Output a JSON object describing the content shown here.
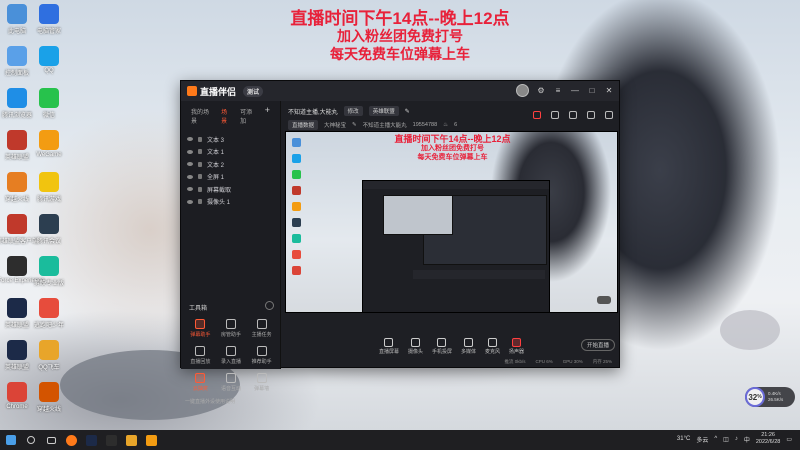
{
  "overlay": {
    "line1": "直播时间下午14点--晚上12点",
    "line2": "加入粉丝团免费打号",
    "line3": "每天免费车位弹幕上车"
  },
  "desktop": {
    "icons": [
      {
        "label": "此电脑",
        "name": "this-pc-icon",
        "color": "#4a90d9"
      },
      {
        "label": "电脑管家",
        "name": "pc-manager-icon",
        "color": "#2f6fe0"
      },
      {
        "label": "控制面板",
        "name": "control-panel-icon",
        "color": "#5aa0e8"
      },
      {
        "label": "QQ",
        "name": "qq-icon",
        "color": "#1aa1e8"
      },
      {
        "label": "腾讯浏览器",
        "name": "browser-icon",
        "color": "#1f8ee6"
      },
      {
        "label": "微信",
        "name": "wechat-icon",
        "color": "#27c24c"
      },
      {
        "label": "英雄联盟",
        "name": "lol-icon",
        "color": "#c0392b"
      },
      {
        "label": "WeGame",
        "name": "wegame-icon",
        "color": "#f39c12"
      },
      {
        "label": "穿越火线",
        "name": "cf-icon",
        "color": "#e67e22"
      },
      {
        "label": "腾讯游戏",
        "name": "tencent-game-icon",
        "color": "#f1c40f"
      },
      {
        "label": "英雄联盟客户端",
        "name": "lol-client-icon",
        "color": "#c0392b"
      },
      {
        "label": "腾讯会议",
        "name": "meeting-icon",
        "color": "#2c3e50"
      },
      {
        "label": "GeForce Experience",
        "name": "nvidia-icon",
        "color": "#2d2d2d"
      },
      {
        "label": "剪映专业版",
        "name": "capcut-icon",
        "color": "#1abc9c"
      },
      {
        "label": "英雄联盟",
        "name": "lol-icon-2",
        "color": "#1c2a48"
      },
      {
        "label": "逃跑吧少年",
        "name": "game-icon-1",
        "color": "#e74c3c"
      },
      {
        "label": "英雄联盟",
        "name": "lol-icon-3",
        "color": "#1c2a48"
      },
      {
        "label": "QQ飞车",
        "name": "speed-icon",
        "color": "#e8a52a"
      },
      {
        "label": "Chrome",
        "name": "chrome-icon",
        "color": "#db4437"
      },
      {
        "label": "穿越火线",
        "name": "cf-icon-2",
        "color": "#d35400"
      }
    ]
  },
  "app": {
    "title": "直播伴侣",
    "version": "测试",
    "left_tabs": [
      "我的场景",
      "场景",
      "可添加"
    ],
    "active_tab_index": 1,
    "scenes": [
      "文本 3",
      "文本 1",
      "文本 2",
      "全屏 1",
      "屏幕截取",
      "摄像头 1"
    ],
    "tools_title": "工具箱",
    "tools": [
      {
        "label": "弹幕助手",
        "hot": true
      },
      {
        "label": "房管助手",
        "hot": false
      },
      {
        "label": "主播任务",
        "hot": false
      },
      {
        "label": "直播回放",
        "hot": false
      },
      {
        "label": "录入直播",
        "hot": false
      },
      {
        "label": "推荐助手",
        "hot": false
      },
      {
        "label": "云抽奖",
        "hot": true
      },
      {
        "label": "语音互动",
        "hot": false
      },
      {
        "label": "弹幕墙",
        "hot": false
      }
    ],
    "tools_more_text": "一键直播外设使用说明",
    "room_title": "不知道主播,大能丸",
    "tag_edit": "修改",
    "tag_category": "英雄联盟",
    "room_status": "直播数据",
    "room_sub": "大神秘宝",
    "room_note": "不知道主播大能丸",
    "room_id": "19554788",
    "room_likes": "6",
    "toolbar": [
      "直播屏幕",
      "摄像头",
      "手机投屏",
      "多媒体",
      "麦克风",
      "扬声器"
    ],
    "go_live": "开始直播",
    "status": [
      "推流 0kb/s",
      "CPU 6%",
      "GPU 30%",
      "内存 25%"
    ]
  },
  "preview": {
    "line1": "直播时间下午14点--晚上12点",
    "line2": "加入粉丝团免费打号",
    "line3": "每天免费车位弹幕上车"
  },
  "widget": {
    "percent": "32",
    "unit": "%",
    "up": "0.4K/s",
    "down": "26.5K/s"
  },
  "taskbar": {
    "temp": "31°C",
    "weather": "多云",
    "lang": "中",
    "time": "21:26",
    "date": "2022/6/28"
  }
}
